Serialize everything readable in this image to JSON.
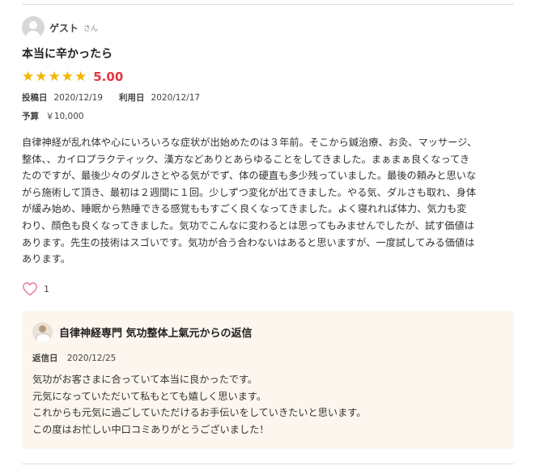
{
  "review": {
    "author": "ゲスト",
    "author_suffix": "さん",
    "title": "本当に辛かったら",
    "stars": 5,
    "score": "5.00",
    "posted_label": "投稿日",
    "posted_date": "2020/12/19",
    "used_label": "利用日",
    "used_date": "2020/12/17",
    "budget_label": "予算",
    "budget_value": "￥10,000",
    "body": "自律神経が乱れ体や心にいろいろな症状が出始めたのは３年前。そこから鍼治療、お灸、マッサージ、\n整体、、カイロプラクティック、漢方などありとあらゆることをしてきました。まぁまぁ良くなってき\nたのですが、最後少々のダルさとやる気がでず、体の硬直も多少残っていました。最後の頼みと思いな\nがら施術して頂き、最初は２週間に１回。少しずつ変化が出てきました。やる気、ダルさも取れ、身体\nが緩み始め、睡眠から熟睡できる感覚ももすごく良くなってきました。よく寝れれば体力、気力も変\nわり、顔色も良くなってきました。気功でこんなに変わるとは思ってもみませんでしたが、試す価値は\nあります。先生の技術はスゴいです。気功が合う合わないはあると思いますが、一度試してみる価値は\nあります。",
    "like_count": "1"
  },
  "reply": {
    "shop_name": "自律神経専門 気功整体上氣元からの返信",
    "date_label": "返信日",
    "date": "2020/12/25",
    "body": "気功がお客さまに合っていて本当に良かったです。\n元気になっていただいて私もとても嬉しく思います。\nこれからも元気に過ごしていただけるお手伝いをしていきたいと思います。\nこの度はお忙しい中口コミありがとうございました！"
  },
  "icons": {
    "avatar": "user-avatar-icon",
    "star": "star-icon",
    "like": "heart-outline-icon",
    "shop": "shop-avatar-icon"
  },
  "colors": {
    "star": "#f2b600",
    "score": "#e8343f",
    "heart": "#e96b8a",
    "reply_bg": "#fdf6ee"
  }
}
